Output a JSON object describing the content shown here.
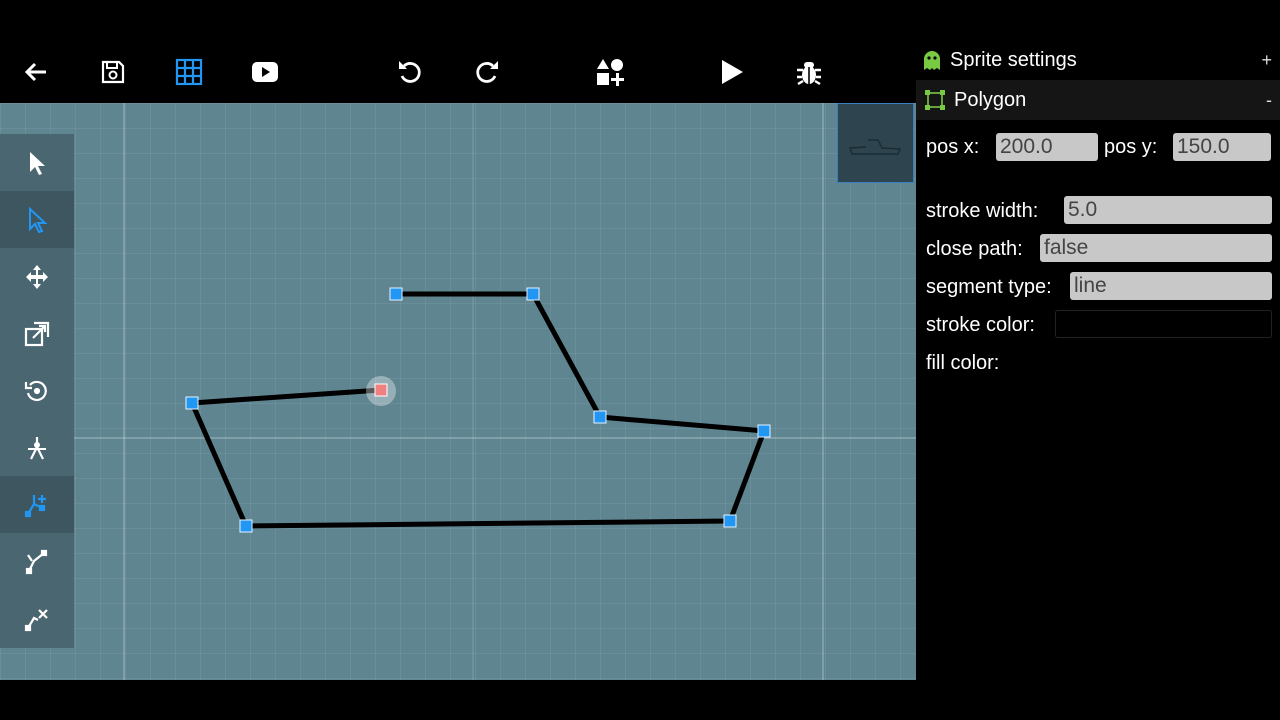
{
  "toolbar": {
    "buttons": [
      {
        "name": "back-arrow-icon"
      },
      {
        "name": "save-icon"
      },
      {
        "name": "grid-icon",
        "active": true
      },
      {
        "name": "video-icon"
      },
      {
        "name": "undo-icon"
      },
      {
        "name": "redo-icon"
      },
      {
        "name": "add-sprite-icon"
      },
      {
        "name": "play-icon"
      },
      {
        "name": "debug-bug-icon"
      }
    ],
    "accent_color": "#2196f3"
  },
  "tools": [
    {
      "name": "select-arrow-icon",
      "active": false
    },
    {
      "name": "select-point-icon",
      "active": true
    },
    {
      "name": "move-icon",
      "active": false
    },
    {
      "name": "resize-icon",
      "active": false
    },
    {
      "name": "rotate-icon",
      "active": false
    },
    {
      "name": "pivot-icon",
      "active": false
    },
    {
      "name": "add-vertex-icon",
      "active": true
    },
    {
      "name": "edit-vertex-icon",
      "active": false
    },
    {
      "name": "delete-vertex-icon",
      "active": false
    }
  ],
  "canvas": {
    "background_color": "#5f8591",
    "shape_stroke_color": "#000000",
    "vertex_color": "#2196f3",
    "selected_vertex_color": "#f08080"
  },
  "panel": {
    "sprite_settings": {
      "title": "Sprite settings",
      "action": "+",
      "icon": "android-ghost-icon"
    },
    "polygon": {
      "title": "Polygon",
      "action": "-",
      "icon": "polygon-icon"
    },
    "pos_x_label": "pos x:",
    "pos_x_value": "200.0",
    "pos_y_label": "pos y:",
    "pos_y_value": "150.0",
    "stroke_width_label": "stroke width:",
    "stroke_width_value": "5.0",
    "close_path_label": "close path:",
    "close_path_value": "false",
    "segment_type_label": "segment type:",
    "segment_type_value": "line",
    "stroke_color_label": "stroke color:",
    "stroke_color_value": "#000000",
    "fill_color_label": "fill color:"
  }
}
